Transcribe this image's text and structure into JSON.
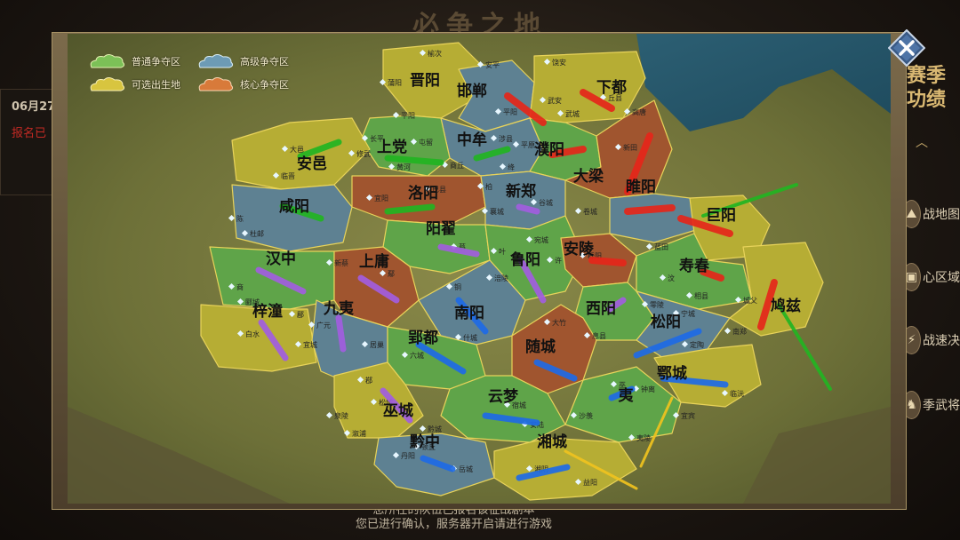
{
  "background": {
    "title": "必争之地",
    "date_partial": "06月27",
    "status_partial": "报名已",
    "season_title_partial": "赛季\n功绩",
    "menu": [
      {
        "icon": "map-icon",
        "label": "战地图"
      },
      {
        "icon": "fortress-icon",
        "label": "心区域"
      },
      {
        "icon": "bolt-icon",
        "label": "战速决"
      },
      {
        "icon": "general-icon",
        "label": "季武将"
      }
    ],
    "bottom_message_line1": "您所在的队伍已报名该征战剧本",
    "bottom_message_line2": "您已进行确认，服务器开启请进行游戏"
  },
  "legend": [
    {
      "label": "普通争夺区",
      "color": "#7cc057"
    },
    {
      "label": "高级争夺区",
      "color": "#6d9bb5"
    },
    {
      "label": "可选出生地",
      "color": "#d8c53f"
    },
    {
      "label": "核心争夺区",
      "color": "#d87a3a"
    }
  ],
  "colors": {
    "normal": "#5fa449",
    "advanced": "#5e8192",
    "spawn": "#b6ad34",
    "core": "#a0552f",
    "stroke_green": "#22b422",
    "stroke_red": "#e5261a",
    "stroke_purple": "#a25de0",
    "stroke_blue": "#1e6ae6",
    "stroke_yellow": "#f0c21e"
  },
  "regions": [
    {
      "name": "晋阳",
      "type": "spawn"
    },
    {
      "name": "邯郸",
      "type": "advanced"
    },
    {
      "name": "下都",
      "type": "spawn"
    },
    {
      "name": "中牟",
      "type": "advanced"
    },
    {
      "name": "上党",
      "type": "normal"
    },
    {
      "name": "安邑",
      "type": "spawn"
    },
    {
      "name": "濮阳",
      "type": "normal"
    },
    {
      "name": "大梁",
      "type": "core"
    },
    {
      "name": "睢阳",
      "type": "advanced"
    },
    {
      "name": "洛阳",
      "type": "core"
    },
    {
      "name": "新郑",
      "type": "advanced"
    },
    {
      "name": "咸阳",
      "type": "advanced"
    },
    {
      "name": "阳翟",
      "type": "normal"
    },
    {
      "name": "巨阳",
      "type": "spawn"
    },
    {
      "name": "汉中",
      "type": "normal"
    },
    {
      "name": "上庸",
      "type": "core"
    },
    {
      "name": "鲁阳",
      "type": "normal"
    },
    {
      "name": "安陵",
      "type": "core"
    },
    {
      "name": "寿春",
      "type": "normal"
    },
    {
      "name": "梓潼",
      "type": "spawn"
    },
    {
      "name": "九夷",
      "type": "advanced"
    },
    {
      "name": "南阳",
      "type": "advanced"
    },
    {
      "name": "西阳",
      "type": "normal"
    },
    {
      "name": "松阳",
      "type": "advanced"
    },
    {
      "name": "鸠兹",
      "type": "spawn"
    },
    {
      "name": "郢都",
      "type": "normal"
    },
    {
      "name": "随城",
      "type": "core"
    },
    {
      "name": "鄂城",
      "type": "spawn"
    },
    {
      "name": "巫城",
      "type": "spawn"
    },
    {
      "name": "云梦",
      "type": "normal"
    },
    {
      "name": "夷",
      "type": "normal"
    },
    {
      "name": "黔中",
      "type": "advanced"
    },
    {
      "name": "湘城",
      "type": "spawn"
    }
  ],
  "cities": [
    "榆次",
    "安平",
    "饶安",
    "武安",
    "平阳",
    "武城",
    "蒲阳",
    "平阳",
    "丘县",
    "高唐",
    "长平",
    "屯留",
    "涉县",
    "平原",
    "新田",
    "大邑",
    "修武",
    "黄河",
    "商丘",
    "绛",
    "临晋",
    "宜阳",
    "柏",
    "谷城",
    "卷城",
    "陈",
    "杜邮",
    "栎阳",
    "蓝田",
    "蔡",
    "叶",
    "宛城",
    "许",
    "新蔡",
    "鄢",
    "铜",
    "商",
    "郾城",
    "汶",
    "郿",
    "广元",
    "相县",
    "城父",
    "南郑",
    "白水",
    "宜城",
    "居巢",
    "六城",
    "什城",
    "大竹",
    "零陵",
    "宁城",
    "息县",
    "巫",
    "鄀",
    "松城",
    "钟离",
    "宜宾",
    "临沅",
    "安陆",
    "沙羡",
    "夷陵",
    "黔城",
    "丹阳",
    "岳城",
    "湘阴",
    "益阳",
    "泉陵",
    "溆浦",
    "涪陵",
    "巴县",
    "襄城",
    "定陶",
    "宿城",
    "顿丘"
  ]
}
